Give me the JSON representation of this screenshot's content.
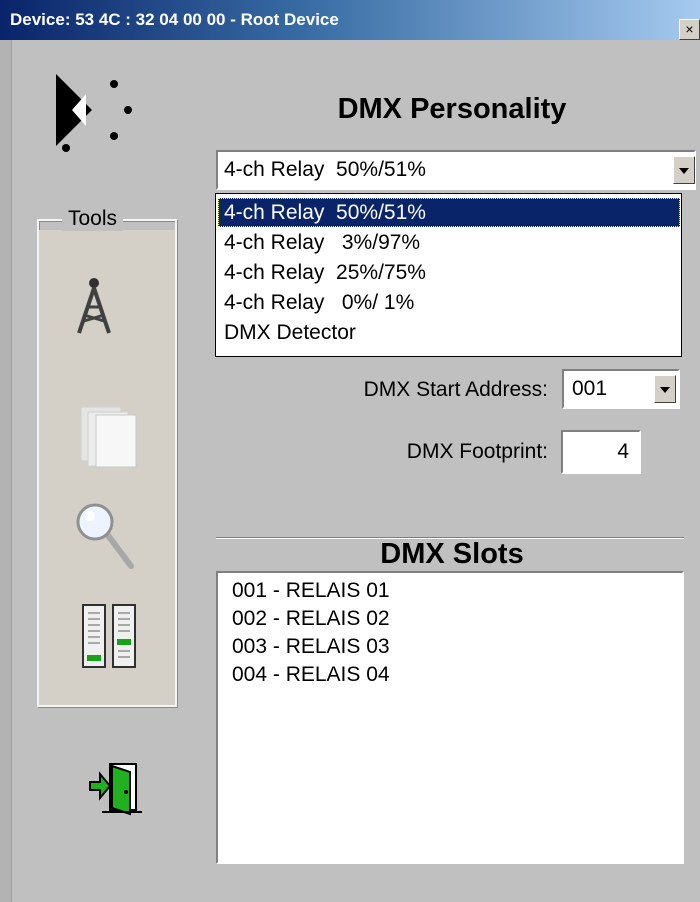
{
  "window": {
    "title": "Device: 53 4C : 32 04 00 00 - Root Device",
    "close_label": "×"
  },
  "tools": {
    "label": "Tools",
    "icons": [
      "antenna-tower-icon",
      "pages-icon",
      "magnifier-icon",
      "faders-icon"
    ],
    "exit_icon": "exit-door-icon"
  },
  "personality": {
    "title": "DMX Personality",
    "selected": "4-ch Relay  50%/51%",
    "options": [
      "4-ch Relay  50%/51%",
      "4-ch Relay   3%/97%",
      "4-ch Relay  25%/75%",
      "4-ch Relay   0%/ 1%",
      "DMX Detector"
    ],
    "highlighted_index": 0
  },
  "start_address": {
    "label": "DMX Start Address:",
    "value": "001"
  },
  "footprint": {
    "label": "DMX Footprint:",
    "value": "4"
  },
  "slots": {
    "title": "DMX Slots",
    "items": [
      "001 - RELAIS 01",
      "002 - RELAIS 02",
      "003 - RELAIS 03",
      "004 - RELAIS 04"
    ]
  },
  "colors": {
    "window_bg": "#c0c0c0",
    "selection": "#0a246a",
    "titlebar_start": "#0a246a",
    "exit_icon_green": "#20b020"
  }
}
